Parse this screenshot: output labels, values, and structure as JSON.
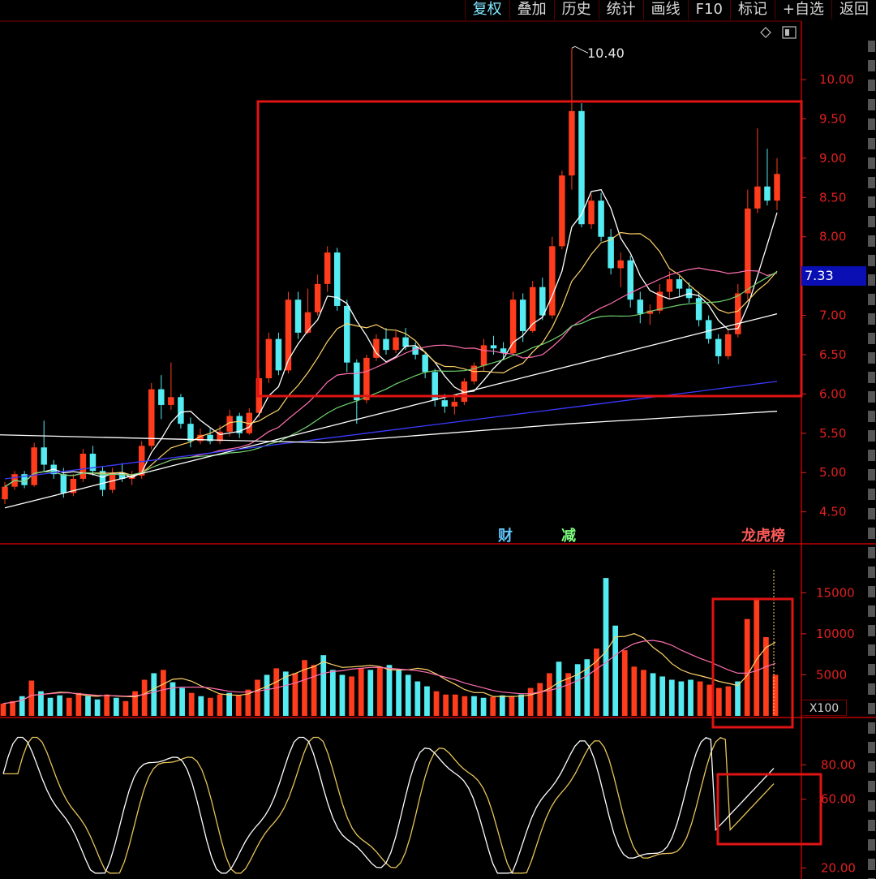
{
  "toolbar": {
    "buttons": [
      "复权",
      "叠加",
      "历史",
      "统计",
      "画线",
      "F10",
      "标记",
      "+自选",
      "返回"
    ],
    "active": "复权"
  },
  "current_price": "7.33",
  "peak_label": "10.40",
  "events": [
    {
      "label": "财",
      "color": "#5fc8ff"
    },
    {
      "label": "减",
      "color": "#7fff7f"
    },
    {
      "label": "龙虎榜",
      "color": "#ff5a5a"
    }
  ],
  "volume_unit": "X100",
  "colors": {
    "up": "#ff3c1c",
    "down": "#54ecf2",
    "axis": "#e02020",
    "highlight": "#e01414",
    "ma5": "#ffffff",
    "ma10": "#ffd36a",
    "ma20": "#ff6fb0",
    "ma30": "#6fd36f",
    "ma60": "#ffffff",
    "ma120": "#3a3aff",
    "ma250": "#ffffff"
  },
  "chart_data": [
    {
      "type": "candlestick",
      "panel": "price",
      "ylim": [
        4.3,
        10.6
      ],
      "yticks": [
        "4.50",
        "5.00",
        "5.50",
        "6.00",
        "6.50",
        "7.00",
        "7.50",
        "8.00",
        "8.50",
        "9.00",
        "9.50",
        "10.00"
      ],
      "n_bars": 80,
      "candles": [
        [
          4.66,
          4.88,
          4.6,
          4.82
        ],
        [
          4.82,
          5.02,
          4.78,
          4.98
        ],
        [
          4.98,
          5.02,
          4.8,
          4.84
        ],
        [
          4.84,
          5.38,
          4.82,
          5.32
        ],
        [
          5.32,
          5.66,
          5.02,
          5.1
        ],
        [
          5.1,
          5.16,
          4.92,
          4.98
        ],
        [
          4.98,
          5.06,
          4.68,
          4.74
        ],
        [
          4.74,
          4.98,
          4.7,
          4.92
        ],
        [
          4.92,
          5.3,
          4.88,
          5.24
        ],
        [
          5.24,
          5.34,
          4.96,
          5.02
        ],
        [
          5.02,
          5.08,
          4.7,
          4.78
        ],
        [
          4.78,
          5.06,
          4.74,
          5.0
        ],
        [
          5.0,
          5.12,
          4.88,
          4.92
        ],
        [
          4.92,
          5.02,
          4.84,
          4.96
        ],
        [
          4.96,
          5.4,
          4.92,
          5.34
        ],
        [
          5.34,
          6.14,
          5.3,
          6.06
        ],
        [
          6.06,
          6.24,
          5.68,
          5.86
        ],
        [
          5.86,
          6.4,
          5.8,
          5.96
        ],
        [
          5.96,
          6.0,
          5.56,
          5.62
        ],
        [
          5.62,
          5.7,
          5.32,
          5.4
        ],
        [
          5.4,
          5.56,
          5.36,
          5.48
        ],
        [
          5.48,
          5.56,
          5.36,
          5.4
        ],
        [
          5.4,
          5.6,
          5.36,
          5.52
        ],
        [
          5.52,
          5.8,
          5.46,
          5.72
        ],
        [
          5.72,
          5.76,
          5.44,
          5.5
        ],
        [
          5.5,
          5.82,
          5.48,
          5.76
        ],
        [
          5.76,
          6.3,
          5.7,
          6.2
        ],
        [
          6.2,
          6.78,
          6.14,
          6.7
        ],
        [
          6.7,
          6.78,
          6.24,
          6.3
        ],
        [
          6.3,
          7.3,
          6.26,
          7.2
        ],
        [
          7.2,
          7.3,
          6.7,
          6.78
        ],
        [
          6.78,
          7.34,
          6.76,
          7.04
        ],
        [
          7.04,
          7.52,
          7.0,
          7.4
        ],
        [
          7.4,
          7.88,
          7.3,
          7.8
        ],
        [
          7.8,
          7.86,
          7.06,
          7.12
        ],
        [
          7.12,
          7.2,
          6.28,
          6.4
        ],
        [
          6.4,
          6.44,
          5.62,
          5.92
        ],
        [
          5.92,
          6.5,
          5.88,
          6.46
        ],
        [
          6.46,
          6.76,
          6.42,
          6.7
        ],
        [
          6.7,
          6.84,
          6.5,
          6.56
        ],
        [
          6.56,
          6.8,
          6.52,
          6.72
        ],
        [
          6.72,
          6.84,
          6.56,
          6.6
        ],
        [
          6.6,
          6.66,
          6.44,
          6.5
        ],
        [
          6.5,
          6.54,
          6.2,
          6.28
        ],
        [
          6.28,
          6.32,
          5.84,
          5.92
        ],
        [
          5.92,
          6.0,
          5.76,
          5.84
        ],
        [
          5.84,
          5.98,
          5.74,
          5.9
        ],
        [
          5.9,
          6.2,
          5.86,
          6.16
        ],
        [
          6.16,
          6.4,
          6.12,
          6.36
        ],
        [
          6.36,
          6.7,
          6.3,
          6.62
        ],
        [
          6.62,
          6.74,
          6.5,
          6.58
        ],
        [
          6.58,
          6.66,
          6.44,
          6.52
        ],
        [
          6.52,
          7.3,
          6.5,
          7.2
        ],
        [
          7.2,
          7.28,
          6.66,
          6.8
        ],
        [
          6.8,
          7.44,
          6.78,
          7.36
        ],
        [
          7.36,
          7.48,
          6.94,
          7.0
        ],
        [
          7.0,
          8.0,
          6.96,
          7.88
        ],
        [
          7.88,
          8.84,
          7.84,
          8.78
        ],
        [
          8.78,
          10.4,
          8.6,
          9.6
        ],
        [
          9.6,
          9.7,
          8.12,
          8.16
        ],
        [
          8.16,
          8.54,
          8.1,
          8.46
        ],
        [
          8.46,
          8.56,
          7.94,
          8.0
        ],
        [
          8.0,
          8.1,
          7.52,
          7.6
        ],
        [
          7.6,
          7.8,
          7.36,
          7.7
        ],
        [
          7.7,
          7.76,
          7.1,
          7.2
        ],
        [
          7.2,
          7.3,
          6.9,
          7.02
        ],
        [
          7.02,
          7.14,
          6.88,
          7.06
        ],
        [
          7.06,
          7.4,
          7.02,
          7.3
        ],
        [
          7.3,
          7.56,
          7.22,
          7.46
        ],
        [
          7.46,
          7.5,
          7.24,
          7.34
        ],
        [
          7.34,
          7.42,
          7.16,
          7.22
        ],
        [
          7.22,
          7.3,
          6.86,
          6.94
        ],
        [
          6.94,
          7.0,
          6.64,
          6.7
        ],
        [
          6.7,
          6.76,
          6.38,
          6.48
        ],
        [
          6.48,
          6.82,
          6.44,
          6.76
        ],
        [
          6.76,
          7.4,
          6.72,
          7.28
        ],
        [
          7.28,
          8.6,
          7.2,
          8.36
        ],
        [
          8.36,
          9.38,
          8.3,
          8.64
        ],
        [
          8.64,
          9.12,
          8.4,
          8.46
        ],
        [
          8.46,
          9.0,
          8.34,
          8.8
        ]
      ]
    },
    {
      "type": "bar",
      "panel": "volume",
      "unit": "X100",
      "ylim": [
        0,
        18000
      ],
      "yticks": [
        "5000",
        "10000",
        "15000"
      ],
      "values": [
        1500,
        1800,
        2400,
        4300,
        3000,
        2200,
        2500,
        2200,
        2800,
        2400,
        2000,
        2600,
        2200,
        1800,
        3000,
        4400,
        5200,
        5600,
        4100,
        3400,
        2800,
        2400,
        2200,
        2600,
        2800,
        2500,
        3200,
        4400,
        5000,
        5800,
        5400,
        5200,
        6800,
        6200,
        7400,
        5600,
        5000,
        4800,
        5800,
        5600,
        6000,
        6200,
        5600,
        5000,
        4200,
        3600,
        3000,
        2600,
        2600,
        2400,
        2400,
        2200,
        2300,
        2500,
        2400,
        2600,
        3400,
        4000,
        5200,
        6600,
        5200,
        6300,
        6900,
        8200,
        16800,
        11000,
        8000,
        6000,
        5600,
        5200,
        4800,
        4400,
        4200,
        4400,
        4200,
        3800,
        3400,
        3600,
        4200,
        11800,
        14200,
        9600,
        5000
      ],
      "ma5": [
        1500,
        1650,
        1900,
        2500,
        2600,
        2740,
        2880,
        2840,
        2640,
        2460,
        2380,
        2500,
        2400,
        2360,
        2320,
        2680,
        3320,
        3880,
        4460,
        4540,
        4220,
        3660,
        3180,
        2680,
        2560,
        2500,
        2660,
        3140,
        3580,
        4140,
        4760,
        5160,
        5640,
        6000,
        6600,
        6240,
        5900,
        5960,
        6040,
        6140,
        6000,
        5600,
        5600,
        5600,
        5800,
        5640,
        5100,
        4400,
        3840,
        3200,
        2840,
        2840,
        2360,
        2360,
        2360,
        2400,
        2560,
        2880,
        3320,
        4100,
        4560,
        5040,
        5740,
        6660,
        7820,
        9620,
        9680,
        10020,
        9500,
        8360,
        7520,
        6360,
        5600,
        5160,
        4900,
        4600,
        4200,
        3960,
        3700,
        4920,
        6880,
        8340,
        8960
      ],
      "ma10": [
        1500,
        1650,
        1900,
        2500,
        2600,
        2700,
        2800,
        2800,
        2700,
        2600,
        2500,
        2450,
        2450,
        2400,
        2450,
        2600,
        2900,
        3200,
        3400,
        3500,
        3500,
        3500,
        3400,
        3200,
        3000,
        2900,
        2900,
        3000,
        3200,
        3400,
        3700,
        4000,
        4400,
        4800,
        5200,
        5400,
        5500,
        5700,
        5800,
        5900,
        5900,
        5800,
        5700,
        5600,
        5500,
        5300,
        5000,
        4700,
        4400,
        4000,
        3700,
        3400,
        3100,
        2900,
        2800,
        2700,
        2700,
        2900,
        3100,
        3400,
        3800,
        4300,
        4900,
        5700,
        6500,
        7400,
        8200,
        8800,
        9100,
        9200,
        9000,
        8600,
        8000,
        7500,
        7000,
        6600,
        6100,
        5600,
        5200,
        5200,
        5500,
        6000,
        6400
      ]
    },
    {
      "type": "line",
      "panel": "oscillator",
      "ylim": [
        15,
        100
      ],
      "yticks": [
        "20.00",
        "60.00",
        "80.00"
      ]
    }
  ]
}
